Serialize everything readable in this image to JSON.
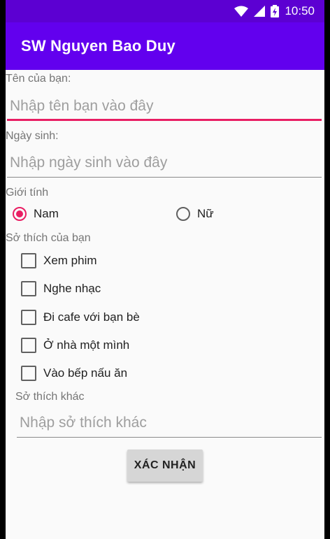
{
  "status_bar": {
    "time": "10:50"
  },
  "app_bar": {
    "title": "SW Nguyen Bao Duy"
  },
  "form": {
    "name_label": "Tên của bạn:",
    "name_placeholder": "Nhập tên bạn vào đây",
    "dob_label": "Ngày sinh:",
    "dob_placeholder": "Nhập ngày sinh vào đây",
    "gender_label": "Giới tính",
    "gender_options": [
      {
        "label": "Nam",
        "selected": true
      },
      {
        "label": "Nữ",
        "selected": false
      }
    ],
    "hobbies_label": "Sở thích của bạn",
    "hobbies": [
      {
        "label": "Xem phim",
        "checked": false
      },
      {
        "label": "Nghe nhạc",
        "checked": false
      },
      {
        "label": "Đi cafe với bạn bè",
        "checked": false
      },
      {
        "label": "Ở nhà một mình",
        "checked": false
      },
      {
        "label": "Vào bếp nấu ăn",
        "checked": false
      }
    ],
    "other_hobby_label": "Sở thích khác",
    "other_hobby_placeholder": "Nhập sở thích khác",
    "submit_label": "XÁC NHẬN"
  },
  "colors": {
    "primary": "#6200ee",
    "primary_dark": "#5c00d2",
    "accent": "#e91e63"
  }
}
